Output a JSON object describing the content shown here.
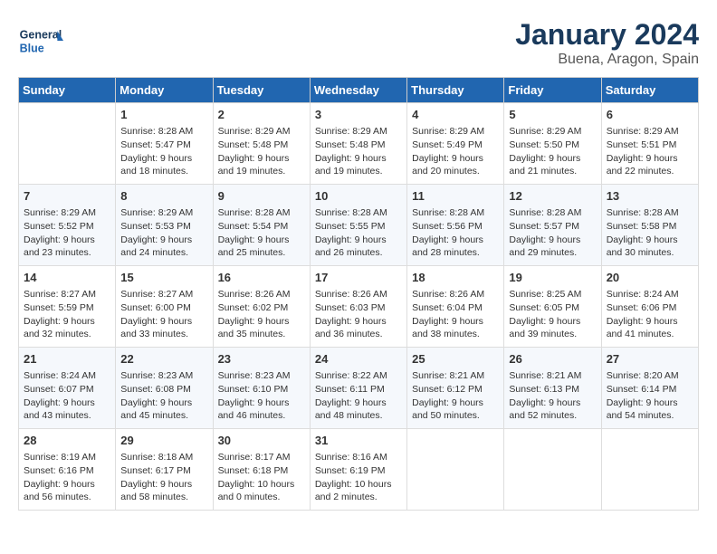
{
  "header": {
    "logo_general": "General",
    "logo_blue": "Blue",
    "month": "January 2024",
    "location": "Buena, Aragon, Spain"
  },
  "weekdays": [
    "Sunday",
    "Monday",
    "Tuesday",
    "Wednesday",
    "Thursday",
    "Friday",
    "Saturday"
  ],
  "weeks": [
    [
      {
        "day": "",
        "info": ""
      },
      {
        "day": "1",
        "info": "Sunrise: 8:28 AM\nSunset: 5:47 PM\nDaylight: 9 hours\nand 18 minutes."
      },
      {
        "day": "2",
        "info": "Sunrise: 8:29 AM\nSunset: 5:48 PM\nDaylight: 9 hours\nand 19 minutes."
      },
      {
        "day": "3",
        "info": "Sunrise: 8:29 AM\nSunset: 5:48 PM\nDaylight: 9 hours\nand 19 minutes."
      },
      {
        "day": "4",
        "info": "Sunrise: 8:29 AM\nSunset: 5:49 PM\nDaylight: 9 hours\nand 20 minutes."
      },
      {
        "day": "5",
        "info": "Sunrise: 8:29 AM\nSunset: 5:50 PM\nDaylight: 9 hours\nand 21 minutes."
      },
      {
        "day": "6",
        "info": "Sunrise: 8:29 AM\nSunset: 5:51 PM\nDaylight: 9 hours\nand 22 minutes."
      }
    ],
    [
      {
        "day": "7",
        "info": "Sunrise: 8:29 AM\nSunset: 5:52 PM\nDaylight: 9 hours\nand 23 minutes."
      },
      {
        "day": "8",
        "info": "Sunrise: 8:29 AM\nSunset: 5:53 PM\nDaylight: 9 hours\nand 24 minutes."
      },
      {
        "day": "9",
        "info": "Sunrise: 8:28 AM\nSunset: 5:54 PM\nDaylight: 9 hours\nand 25 minutes."
      },
      {
        "day": "10",
        "info": "Sunrise: 8:28 AM\nSunset: 5:55 PM\nDaylight: 9 hours\nand 26 minutes."
      },
      {
        "day": "11",
        "info": "Sunrise: 8:28 AM\nSunset: 5:56 PM\nDaylight: 9 hours\nand 28 minutes."
      },
      {
        "day": "12",
        "info": "Sunrise: 8:28 AM\nSunset: 5:57 PM\nDaylight: 9 hours\nand 29 minutes."
      },
      {
        "day": "13",
        "info": "Sunrise: 8:28 AM\nSunset: 5:58 PM\nDaylight: 9 hours\nand 30 minutes."
      }
    ],
    [
      {
        "day": "14",
        "info": "Sunrise: 8:27 AM\nSunset: 5:59 PM\nDaylight: 9 hours\nand 32 minutes."
      },
      {
        "day": "15",
        "info": "Sunrise: 8:27 AM\nSunset: 6:00 PM\nDaylight: 9 hours\nand 33 minutes."
      },
      {
        "day": "16",
        "info": "Sunrise: 8:26 AM\nSunset: 6:02 PM\nDaylight: 9 hours\nand 35 minutes."
      },
      {
        "day": "17",
        "info": "Sunrise: 8:26 AM\nSunset: 6:03 PM\nDaylight: 9 hours\nand 36 minutes."
      },
      {
        "day": "18",
        "info": "Sunrise: 8:26 AM\nSunset: 6:04 PM\nDaylight: 9 hours\nand 38 minutes."
      },
      {
        "day": "19",
        "info": "Sunrise: 8:25 AM\nSunset: 6:05 PM\nDaylight: 9 hours\nand 39 minutes."
      },
      {
        "day": "20",
        "info": "Sunrise: 8:24 AM\nSunset: 6:06 PM\nDaylight: 9 hours\nand 41 minutes."
      }
    ],
    [
      {
        "day": "21",
        "info": "Sunrise: 8:24 AM\nSunset: 6:07 PM\nDaylight: 9 hours\nand 43 minutes."
      },
      {
        "day": "22",
        "info": "Sunrise: 8:23 AM\nSunset: 6:08 PM\nDaylight: 9 hours\nand 45 minutes."
      },
      {
        "day": "23",
        "info": "Sunrise: 8:23 AM\nSunset: 6:10 PM\nDaylight: 9 hours\nand 46 minutes."
      },
      {
        "day": "24",
        "info": "Sunrise: 8:22 AM\nSunset: 6:11 PM\nDaylight: 9 hours\nand 48 minutes."
      },
      {
        "day": "25",
        "info": "Sunrise: 8:21 AM\nSunset: 6:12 PM\nDaylight: 9 hours\nand 50 minutes."
      },
      {
        "day": "26",
        "info": "Sunrise: 8:21 AM\nSunset: 6:13 PM\nDaylight: 9 hours\nand 52 minutes."
      },
      {
        "day": "27",
        "info": "Sunrise: 8:20 AM\nSunset: 6:14 PM\nDaylight: 9 hours\nand 54 minutes."
      }
    ],
    [
      {
        "day": "28",
        "info": "Sunrise: 8:19 AM\nSunset: 6:16 PM\nDaylight: 9 hours\nand 56 minutes."
      },
      {
        "day": "29",
        "info": "Sunrise: 8:18 AM\nSunset: 6:17 PM\nDaylight: 9 hours\nand 58 minutes."
      },
      {
        "day": "30",
        "info": "Sunrise: 8:17 AM\nSunset: 6:18 PM\nDaylight: 10 hours\nand 0 minutes."
      },
      {
        "day": "31",
        "info": "Sunrise: 8:16 AM\nSunset: 6:19 PM\nDaylight: 10 hours\nand 2 minutes."
      },
      {
        "day": "",
        "info": ""
      },
      {
        "day": "",
        "info": ""
      },
      {
        "day": "",
        "info": ""
      }
    ]
  ]
}
